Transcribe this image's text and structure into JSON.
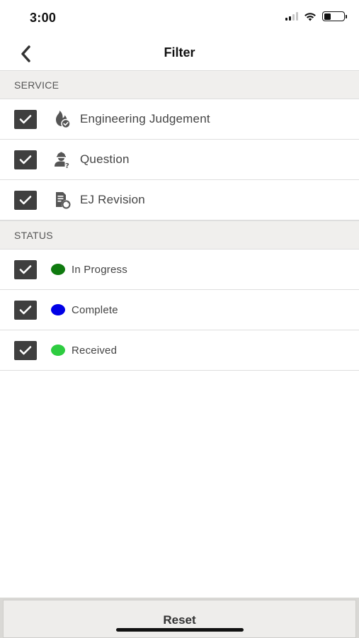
{
  "status_bar": {
    "time": "3:00",
    "signal_icon": "cellular-signal-icon",
    "wifi_icon": "wifi-icon",
    "battery_icon": "battery-icon"
  },
  "nav": {
    "title": "Filter",
    "back_icon": "chevron-left-icon"
  },
  "service_section": {
    "header": "SERVICE",
    "items": [
      {
        "label": "Engineering Judgement",
        "icon": "fire-check-icon",
        "checked": true
      },
      {
        "label": "Question",
        "icon": "worker-question-icon",
        "checked": true
      },
      {
        "label": "EJ Revision",
        "icon": "document-revision-icon",
        "checked": true
      }
    ]
  },
  "status_section": {
    "header": "STATUS",
    "items": [
      {
        "label": "In Progress",
        "color": "#0f7a0f",
        "checked": true
      },
      {
        "label": "Complete",
        "color": "#0000e6",
        "checked": true
      },
      {
        "label": "Received",
        "color": "#2ecc40",
        "checked": true
      }
    ]
  },
  "footer": {
    "reset_label": "Reset"
  },
  "colors": {
    "checkbox_fill": "#3f3f3f",
    "section_bg": "#f0efed",
    "footer_bg": "#d9d8d5"
  }
}
